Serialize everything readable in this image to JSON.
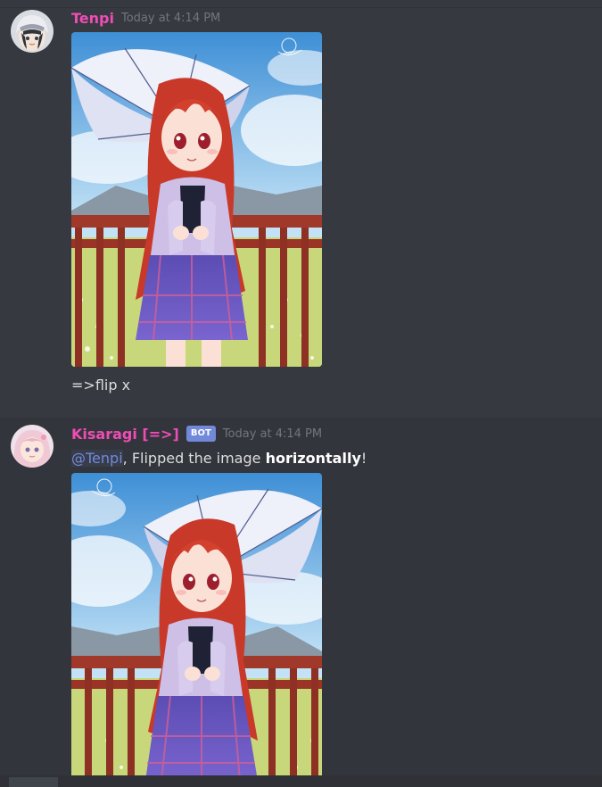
{
  "messages": [
    {
      "username": "Tenpi",
      "username_color": "#f04cb5",
      "timestamp": "Today at 4:14 PM",
      "text": "=>flip x"
    },
    {
      "username": "Kisaragi [=>]",
      "username_color": "#f04cb5",
      "bot_tag": "BOT",
      "timestamp": "Today at 4:14 PM",
      "mention": "@Tenpi",
      "text_before": ", Flipped the image ",
      "text_bold": "horizontally",
      "text_after": "!"
    }
  ],
  "colors": {
    "background": "#36393f",
    "hover_background": "#32353b",
    "mention": "#7289da",
    "bot_tag": "#7289da",
    "timestamp": "#72767d",
    "text": "#dcddde"
  }
}
